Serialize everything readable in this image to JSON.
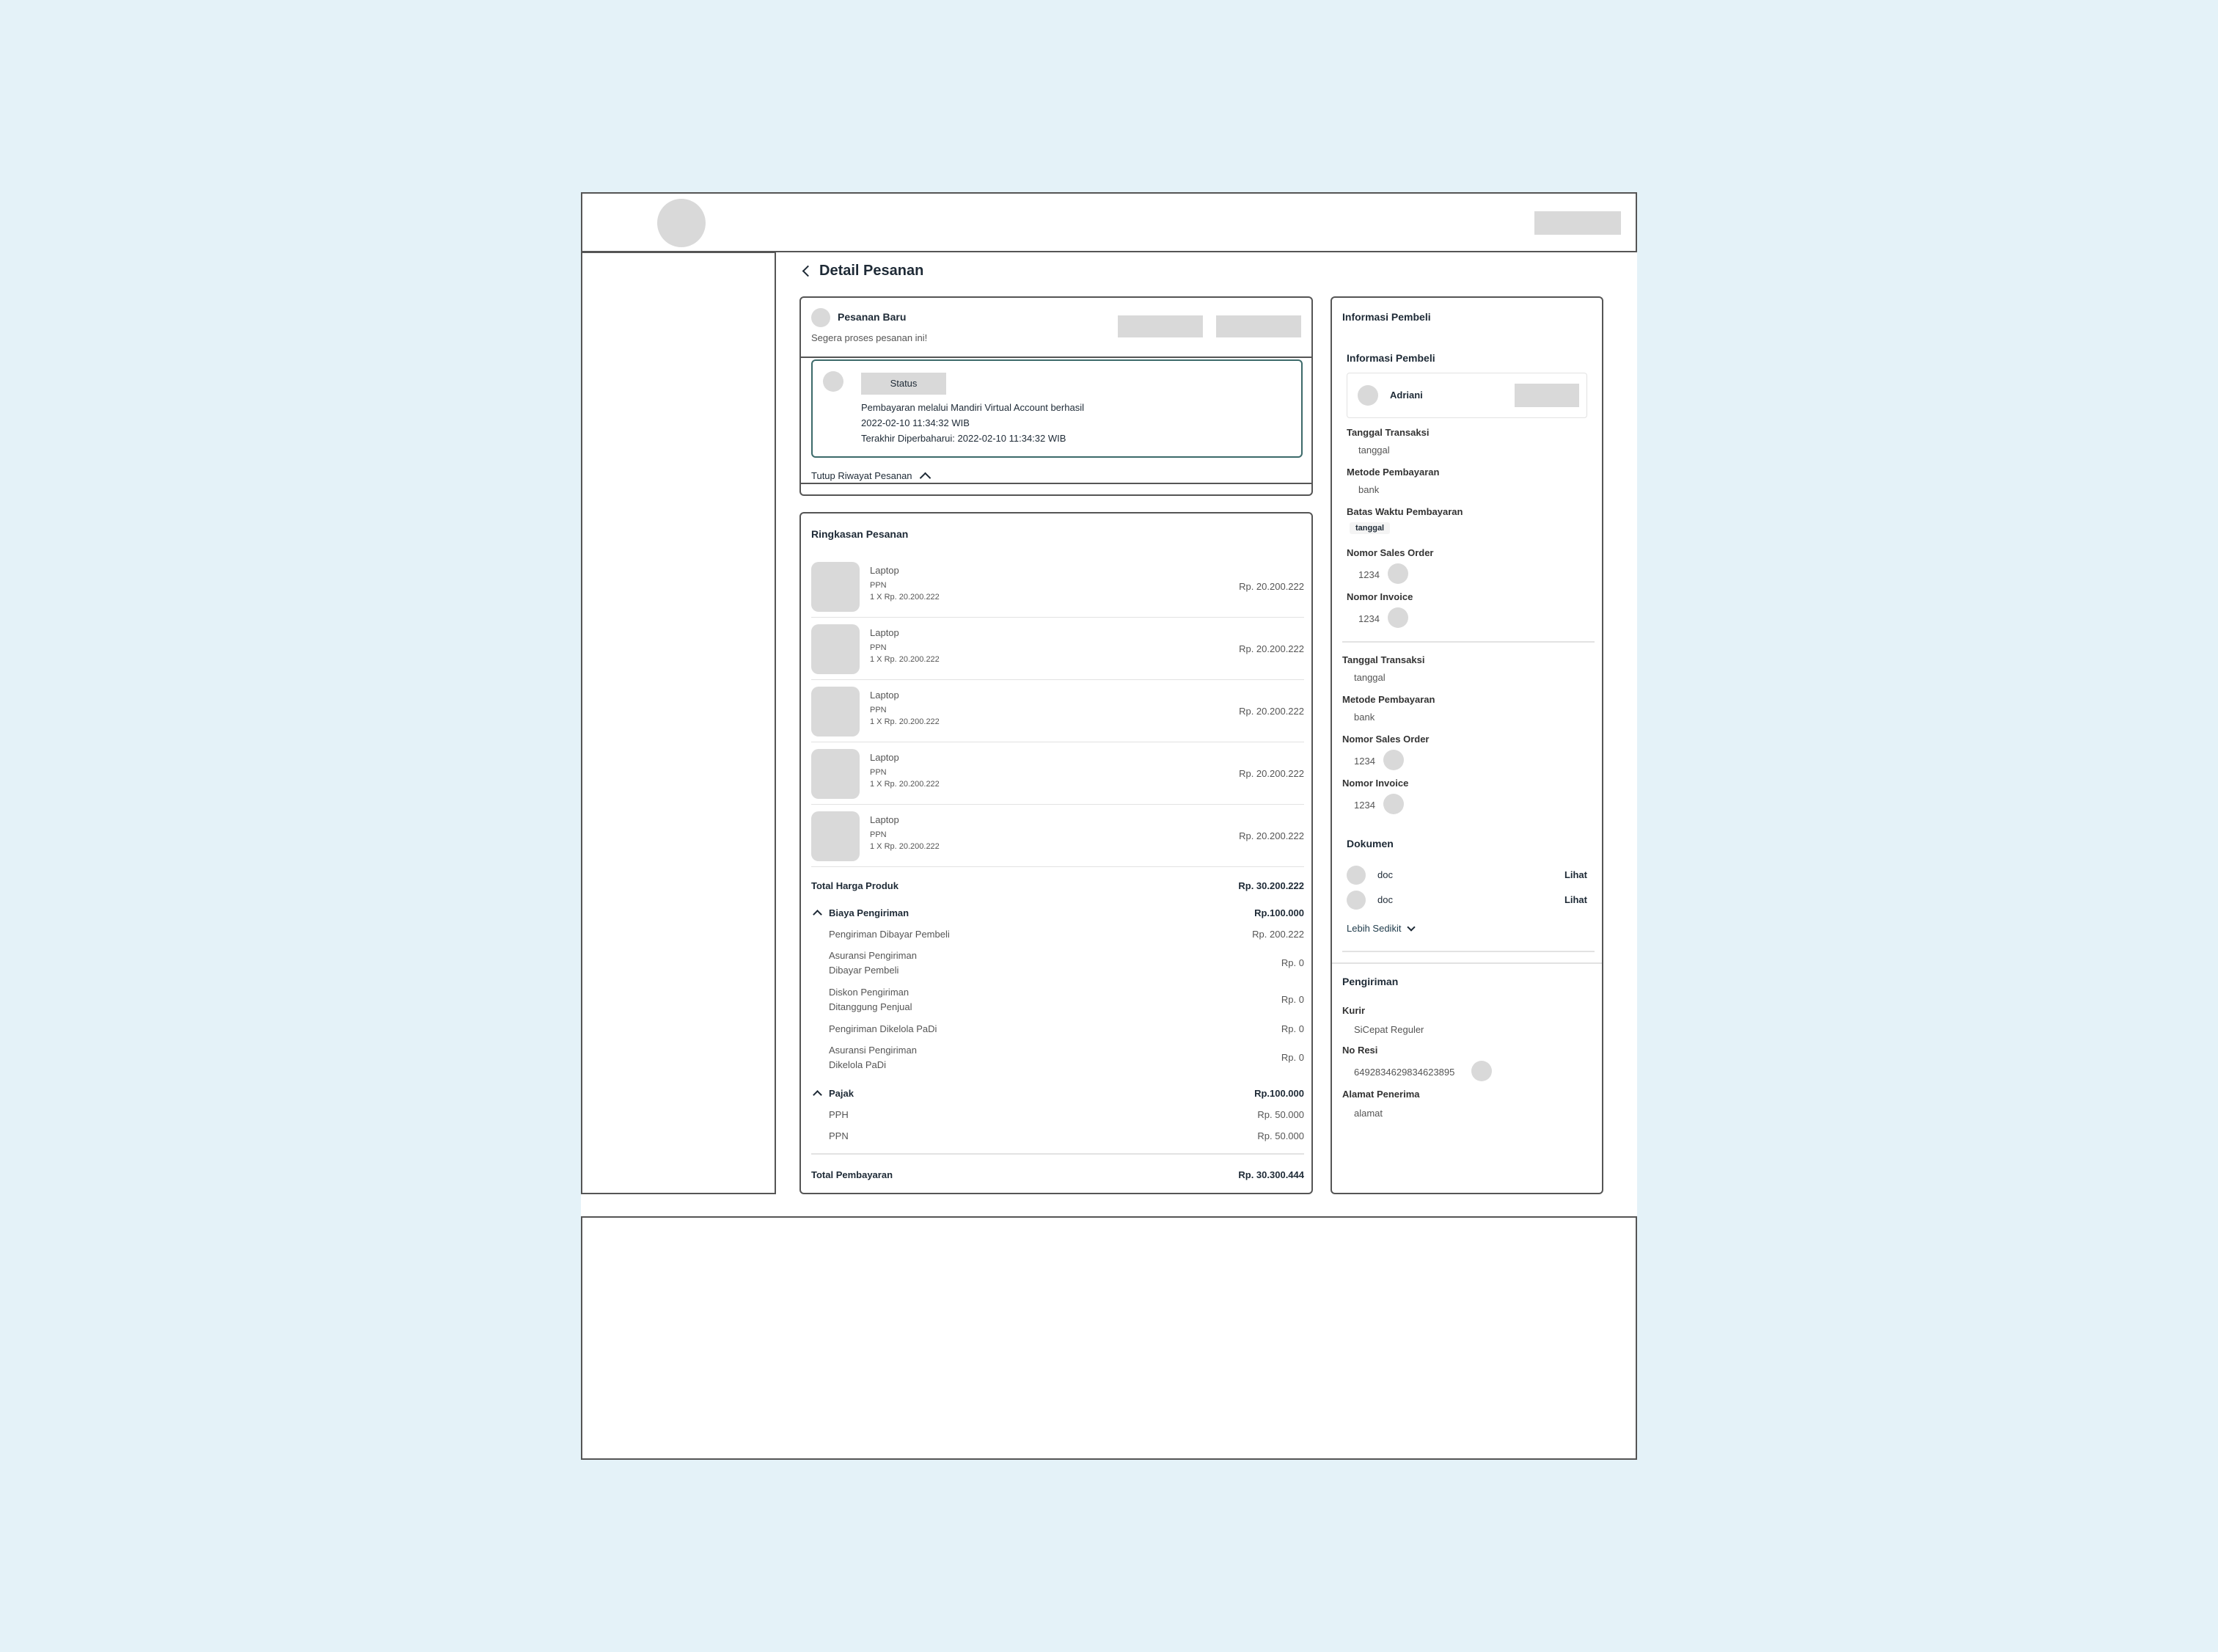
{
  "page_title": "Detail Pesanan",
  "order": {
    "status_title": "Pesanan Baru",
    "status_subtitle": "Segera proses pesanan ini!",
    "history": {
      "status_label": "Status",
      "line1": "Pembayaran melalui Mandiri Virtual Account berhasil",
      "line2": "2022-02-10 11:34:32 WIB",
      "line3": "Terakhir Diperbaharui: 2022-02-10 11:34:32 WIB"
    },
    "close_history_label": "Tutup Riwayat Pesanan"
  },
  "summary": {
    "title": "Ringkasan Pesanan",
    "products": [
      {
        "name": "Laptop",
        "tax": "PPN",
        "qty": "1 X Rp. 20.200.222",
        "price": "Rp. 20.200.222"
      },
      {
        "name": "Laptop",
        "tax": "PPN",
        "qty": "1 X Rp. 20.200.222",
        "price": "Rp. 20.200.222"
      },
      {
        "name": "Laptop",
        "tax": "PPN",
        "qty": "1 X Rp. 20.200.222",
        "price": "Rp. 20.200.222"
      },
      {
        "name": "Laptop",
        "tax": "PPN",
        "qty": "1 X Rp. 20.200.222",
        "price": "Rp. 20.200.222"
      },
      {
        "name": "Laptop",
        "tax": "PPN",
        "qty": "1 X Rp. 20.200.222",
        "price": "Rp. 20.200.222"
      }
    ],
    "total_product_label": "Total Harga Produk",
    "total_product_value": "Rp. 30.200.222",
    "shipping": {
      "label": "Biaya Pengiriman",
      "value": "Rp.100.000",
      "items": [
        {
          "label1": "Pengiriman Dibayar Pembeli",
          "label2": "",
          "value": "Rp. 200.222"
        },
        {
          "label1": "Asuransi Pengiriman",
          "label2": "Dibayar Pembeli",
          "value": "Rp. 0"
        },
        {
          "label1": "Diskon Pengiriman",
          "label2": "Ditanggung Penjual",
          "value": "Rp. 0"
        },
        {
          "label1": "Pengiriman Dikelola PaDi",
          "label2": "",
          "value": "Rp. 0"
        },
        {
          "label1": "Asuransi Pengiriman",
          "label2": "Dikelola PaDi",
          "value": "Rp. 0"
        }
      ]
    },
    "tax": {
      "label": "Pajak",
      "value": "Rp.100.000",
      "items": [
        {
          "label": "PPH",
          "value": "Rp. 50.000"
        },
        {
          "label": "PPN",
          "value": "Rp. 50.000"
        }
      ]
    },
    "total_payment_label": "Total Pembayaran",
    "total_payment_value": "Rp. 30.300.444"
  },
  "buyer": {
    "card_title": "Informasi Pembeli",
    "section_title": "Informasi Pembeli",
    "name": "Adriani",
    "fields": [
      {
        "label": "Tanggal Transaksi",
        "value": "tanggal"
      },
      {
        "label": "Metode Pembayaran",
        "value": "bank"
      },
      {
        "label": "Batas Waktu Pembayaran",
        "value": "tanggal"
      },
      {
        "label": "Nomor Sales Order",
        "value": "1234"
      },
      {
        "label": "Nomor Invoice",
        "value": "1234"
      }
    ],
    "fields2": [
      {
        "label": "Tanggal Transaksi",
        "value": "tanggal"
      },
      {
        "label": "Metode Pembayaran",
        "value": "bank"
      },
      {
        "label": "Nomor Sales Order",
        "value": "1234"
      },
      {
        "label": "Nomor Invoice",
        "value": "1234"
      }
    ],
    "documents": {
      "title": "Dokumen",
      "items": [
        {
          "name": "doc",
          "action": "Lihat"
        },
        {
          "name": "doc",
          "action": "Lihat"
        }
      ],
      "less_label": "Lebih Sedikit"
    },
    "shipping": {
      "title": "Pengiriman",
      "courier_label": "Kurir",
      "courier_value": "SiCepat Reguler",
      "resi_label": "No Resi",
      "resi_value": "6492834629834623895",
      "address_label": "Alamat Penerima",
      "address_value": "alamat"
    }
  }
}
